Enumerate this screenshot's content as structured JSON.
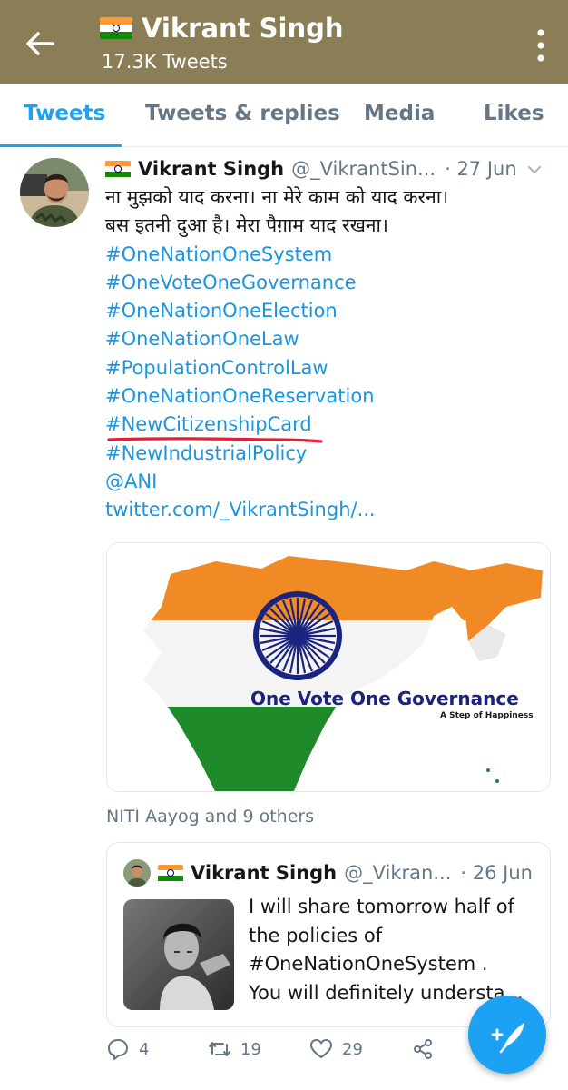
{
  "header": {
    "name": "Vikrant Singh",
    "tweet_count": "17.3K Tweets",
    "flag_icon": "india-flag-icon",
    "bg_color": "#8b7e57"
  },
  "tabs": [
    {
      "label": "Tweets",
      "active": true
    },
    {
      "label": "Tweets & replies",
      "active": false
    },
    {
      "label": "Media",
      "active": false
    },
    {
      "label": "Likes",
      "active": false
    }
  ],
  "tweet": {
    "name": "Vikrant Singh",
    "handle": "@_VikrantSin...",
    "date": "· 27 Jun",
    "text_lines": [
      "ना मुझको याद करना। ना मेरे काम को याद करना।",
      "बस इतनी दुआ है। मेरा पैग़ाम याद रखना।"
    ],
    "hashtags": [
      "#OneNationOneSystem",
      "#OneVoteOneGovernance",
      "#OneNationOneElection",
      "#OneNationOneLaw",
      "#PopulationControlLaw",
      "#OneNationOneReservation",
      "#NewCitizenshipCard",
      "#NewIndustrialPolicy"
    ],
    "mention": "@ANI",
    "url": "twitter.com/_VikrantSingh/...",
    "media": {
      "headline": "One Vote One Governance",
      "tagline": "A Step of Happiness"
    },
    "liked_by": "NITI Aayog and 9 others",
    "quote": {
      "name": "Vikrant Singh",
      "handle": "@_Vikran...",
      "date": "· 26 Jun",
      "text_lines": [
        "I will share tomorrow half of",
        "the policies of",
        "#OneNationOneSystem .",
        "You will definitely understa..."
      ]
    },
    "actions": {
      "replies": "4",
      "retweets": "19",
      "likes": "29"
    }
  },
  "colors": {
    "accent": "#1da1f2",
    "link": "#1b95e0",
    "muted": "#657786",
    "annotation_red": "#e0203a"
  }
}
